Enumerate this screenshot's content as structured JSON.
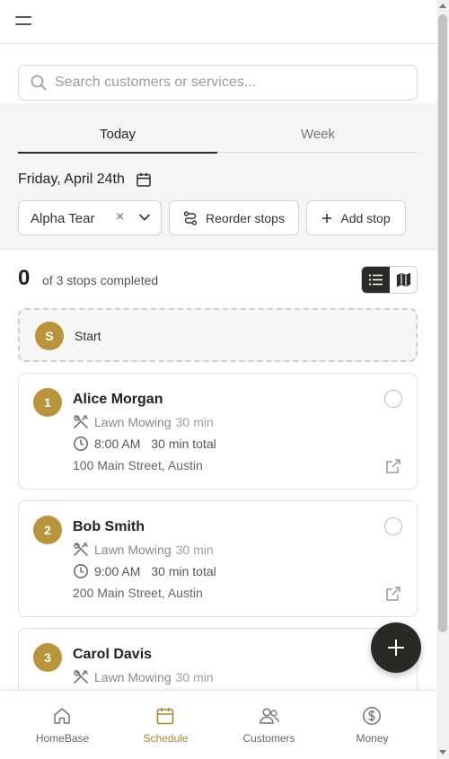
{
  "colors": {
    "accent": "#b8953c",
    "dark": "#2b2a27",
    "active_nav": "#a88735"
  },
  "header": {
    "menu_icon": "hamburger-icon"
  },
  "search": {
    "placeholder": "Search customers or services..."
  },
  "tabs": [
    {
      "label": "Today",
      "active": true
    },
    {
      "label": "Week",
      "active": false
    }
  ],
  "date": {
    "label": "Friday, April 24th",
    "icon": "calendar-icon"
  },
  "filter": {
    "selected": "Alpha Tear",
    "clear_glyph": "×"
  },
  "actions": {
    "reorder_label": "Reorder stops",
    "add_label": "Add stop"
  },
  "progress": {
    "completed": "0",
    "label": "of 3 stops completed",
    "view_options": [
      "list",
      "map"
    ],
    "view_selected": "list"
  },
  "start": {
    "badge": "S",
    "label": "Start"
  },
  "stops": [
    {
      "number": "1",
      "name": "Alice Morgan",
      "service": "Lawn Mowing",
      "service_duration": "30 min",
      "time": "8:00 AM",
      "total": "30 min total",
      "address": "100 Main Street, Austin"
    },
    {
      "number": "2",
      "name": "Bob Smith",
      "service": "Lawn Mowing",
      "service_duration": "30 min",
      "time": "9:00 AM",
      "total": "30 min total",
      "address": "200 Main Street, Austin"
    },
    {
      "number": "3",
      "name": "Carol Davis",
      "service": "Lawn Mowing",
      "service_duration": "30 min",
      "time": "",
      "total": "",
      "address": ""
    }
  ],
  "nav": [
    {
      "label": "HomeBase",
      "icon": "home-icon",
      "active": false
    },
    {
      "label": "Schedule",
      "icon": "calendar-icon",
      "active": true
    },
    {
      "label": "Customers",
      "icon": "users-icon",
      "active": false
    },
    {
      "label": "Money",
      "icon": "dollar-icon",
      "active": false
    }
  ]
}
